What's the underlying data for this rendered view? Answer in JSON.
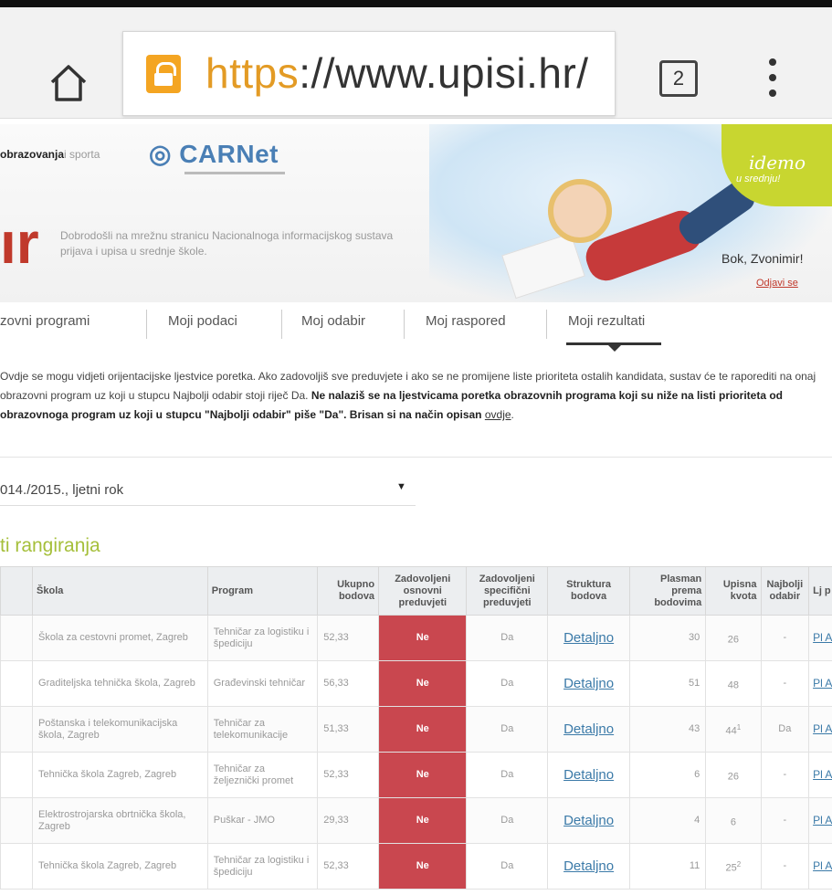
{
  "browser": {
    "url_scheme": "https",
    "url_rest": "://www.upisi.hr/",
    "tab_count": "2"
  },
  "header": {
    "ministry_strong": "obrazovanja",
    "ministry_rest": "i sporta",
    "carnet": "CARNet",
    "logo_letters": "ır",
    "welcome": "Dobrodošli na mrežnu stranicu Nacionalnoga informacijskog sustava prijava i upisa u srednje škole.",
    "idemo": "idemo",
    "idemo_sub": "u srednju!",
    "greeting": "Bok, Zvonimir!",
    "logout": "Odjavi se"
  },
  "nav": {
    "items": [
      "zovni programi",
      "Moji podaci",
      "Moj odabir",
      "Moj raspored",
      "Moji rezultati"
    ],
    "active": "Moji rezultati"
  },
  "info": {
    "p1": "Ovdje se mogu vidjeti orijentacijske ljestvice poretka. Ako zadovoljiš sve preduvjete i ako se ne promijene liste prioriteta ostalih kandidata, sustav će te raporediti na onaj obrazovni program uz koji u stupcu Najbolji odabir stoji riječ Da.",
    "p2": "Ne nalaziš se na ljestvicama poretka obrazovnih programa koji su niže na listi prioriteta od obrazovnoga program uz koji u stupcu \"Najbolji odabir\" piše \"Da\". Brisan si na način opisan",
    "link": "ovdje",
    "period": ".",
    "prefix1": "O",
    "prefix2": "k",
    "prefix3": "lj",
    "prefix4": "p"
  },
  "term_select": {
    "value": "014./2015., ljetni rok",
    "caret": "▼"
  },
  "section_title": "ti rangiranja",
  "table": {
    "headers": {
      "skola": "Škola",
      "program": "Program",
      "ukupno": "Ukupno bodova",
      "osnovni": "Zadovoljeni osnovni preduvjeti",
      "specificni": "Zadovoljeni specifični preduvjeti",
      "struktura": "Struktura bodova",
      "plasman": "Plasman prema bodovima",
      "kvota": "Upisna kvota",
      "najbolji": "Najbolji odabir",
      "edge": "Lj p"
    },
    "rows": [
      {
        "skola": "Škola za cestovni promet, Zagreb",
        "program": "Tehničar za logistiku i špediciju",
        "bodovi": "52,33",
        "osnovni": "Ne",
        "specificni": "Da",
        "struktura": "Detaljno",
        "plasman": "30",
        "kvota": "26",
        "kvota_sup": "",
        "najbolji": "-",
        "edge": "Pl Ab"
      },
      {
        "skola": "Graditeljska tehnička škola, Zagreb",
        "program": "Građevinski tehničar",
        "bodovi": "56,33",
        "osnovni": "Ne",
        "specificni": "Da",
        "struktura": "Detaljno",
        "plasman": "51",
        "kvota": "48",
        "kvota_sup": "",
        "najbolji": "-",
        "edge": "Pl Ab"
      },
      {
        "skola": "Poštanska i telekomunikacijska škola, Zagreb",
        "program": "Tehničar za telekomunikacije",
        "bodovi": "51,33",
        "osnovni": "Ne",
        "specificni": "Da",
        "struktura": "Detaljno",
        "plasman": "43",
        "kvota": "44",
        "kvota_sup": "1",
        "najbolji": "Da",
        "edge": "Pl Ab"
      },
      {
        "skola": "Tehnička škola Zagreb, Zagreb",
        "program": "Tehničar za željeznički promet",
        "bodovi": "52,33",
        "osnovni": "Ne",
        "specificni": "Da",
        "struktura": "Detaljno",
        "plasman": "6",
        "kvota": "26",
        "kvota_sup": "",
        "najbolji": "-",
        "edge": "Pl Ab"
      },
      {
        "skola": "Elektrostrojarska obrtnička škola, Zagreb",
        "program": "Puškar - JMO",
        "bodovi": "29,33",
        "osnovni": "Ne",
        "specificni": "Da",
        "struktura": "Detaljno",
        "plasman": "4",
        "kvota": "6",
        "kvota_sup": "",
        "najbolji": "-",
        "edge": "Pl Ab"
      },
      {
        "skola": "Tehnička škola Zagreb, Zagreb",
        "program": "Tehničar za logistiku i špediciju",
        "bodovi": "52,33",
        "osnovni": "Ne",
        "specificni": "Da",
        "struktura": "Detaljno",
        "plasman": "11",
        "kvota": "25",
        "kvota_sup": "2",
        "najbolji": "-",
        "edge": "Pl Ab"
      }
    ]
  },
  "colors": {
    "accent_green": "#a5bf3a",
    "status_red": "#c9474f",
    "link_blue": "#3b7aa8",
    "brand_red": "#c0392b"
  },
  "icons": {
    "home": "home-icon",
    "lock": "lock-icon",
    "menu": "kebab-menu-icon"
  }
}
